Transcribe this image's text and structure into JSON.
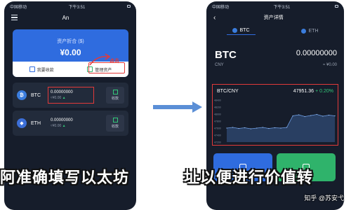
{
  "left_phone": {
    "status": {
      "carrier": "中国移动",
      "time": "下午3:51"
    },
    "header": {
      "title": "An"
    },
    "asset": {
      "title": "资产折合 ($)",
      "value": "¥0.00"
    },
    "buttons": {
      "receive": "我要收款",
      "manage": "管理资产"
    },
    "click_label": "点击",
    "coins": [
      {
        "symbol": "BTC",
        "amount": "0.00000000",
        "fiat": "≈¥0.00",
        "trend": "▲",
        "action": "收款"
      },
      {
        "symbol": "ETH",
        "amount": "0.00000000",
        "fiat": "≈¥0.00",
        "trend": "▲",
        "action": "收款"
      }
    ]
  },
  "right_phone": {
    "status": {
      "carrier": "中国移动",
      "time": "下午3:51"
    },
    "header": {
      "title": "资产详情"
    },
    "tabs": [
      {
        "label": "BTC",
        "active": true
      },
      {
        "label": "ETH",
        "active": false
      }
    ],
    "coin": {
      "name": "BTC",
      "balance": "0.00000000",
      "currency": "CNY",
      "fiat": "≈ ¥0.00"
    },
    "chart": {
      "pair": "BTC/CNY",
      "price": "47951.36",
      "change": "+ 0.20%",
      "y_ticks": [
        "48400",
        "48200",
        "48000",
        "47800",
        "47600",
        "47400",
        "47200"
      ]
    }
  },
  "caption": {
    "left": "阿准确填写以太坊",
    "right": "址以便进行价值转"
  },
  "watermark": "知乎 @苏安弋",
  "chart_data": {
    "type": "area",
    "pair": "BTC/CNY",
    "values": [
      47600,
      47620,
      47590,
      47610,
      47580,
      47600,
      47620,
      47590,
      47610,
      47600,
      47620,
      47950,
      47980,
      47930,
      47960,
      47990,
      47940,
      47970,
      47950
    ],
    "ylim": [
      47200,
      48400
    ]
  }
}
